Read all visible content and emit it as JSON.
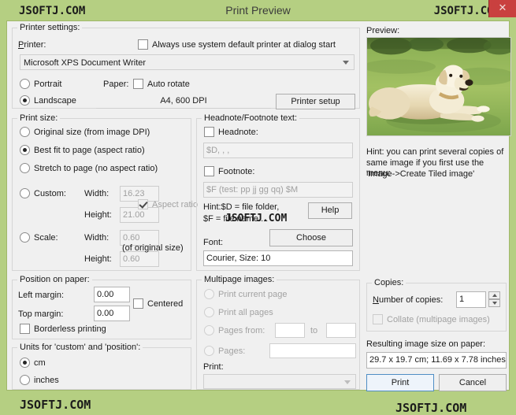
{
  "window": {
    "title": "Print Preview",
    "close_label": "✕",
    "watermark": "JSOFTJ.COM",
    "titlebar_color": "#b5cf82",
    "close_color": "#c9403f",
    "accent_color": "#4f8ec4"
  },
  "printer_settings": {
    "legend": "Printer settings:",
    "printer_label": "Printer:",
    "always_default_label": "Always use system default printer at dialog start",
    "always_default_checked": false,
    "printer_value": "Microsoft XPS Document Writer",
    "orientation": {
      "portrait_label": "Portrait",
      "landscape_label": "Landscape",
      "selected": "Landscape"
    },
    "paper_label": "Paper:",
    "auto_rotate_label": "Auto rotate",
    "auto_rotate_checked": false,
    "paper_value": "A4,      600 DPI",
    "printer_setup_label": "Printer setup"
  },
  "print_size": {
    "legend": "Print size:",
    "original_label": "Original size (from image DPI)",
    "best_fit_label": "Best fit to page (aspect ratio)",
    "stretch_label": "Stretch to page (no aspect ratio)",
    "custom_label": "Custom:",
    "scale_label": "Scale:",
    "selected": "best_fit",
    "width_label": "Width:",
    "height_label": "Height:",
    "custom_width": "16.23",
    "custom_height": "21.00",
    "aspect_ratio_label": "Aspect ratio",
    "aspect_ratio_checked": true,
    "scale_width": "0.60",
    "scale_height": "0.60",
    "of_original_label": "(of original size)"
  },
  "headnote": {
    "legend": "Headnote/Footnote text:",
    "headnote_label": "Headnote:",
    "headnote_checked": false,
    "headnote_value": "$D, , ,",
    "footnote_label": "Footnote:",
    "footnote_checked": false,
    "footnote_value": "$F (test: pp jj gg qq) $M",
    "hint_line1": "Hint:$D = file folder,",
    "hint_line2": "$F = file name ...",
    "help_label": "Help",
    "font_label": "Font:",
    "choose_label": "Choose",
    "font_value": "Courier, Size: 10"
  },
  "position": {
    "legend": "Position on paper:",
    "left_margin_label": "Left margin:",
    "left_margin_value": "0.00",
    "top_margin_label": "Top margin:",
    "top_margin_value": "0.00",
    "centered_label": "Centered",
    "centered_checked": false,
    "borderless_label": "Borderless printing",
    "borderless_checked": false
  },
  "units": {
    "legend": "Units for 'custom' and 'position':",
    "cm_label": "cm",
    "inches_label": "inches",
    "selected": "cm"
  },
  "multipage": {
    "legend": "Multipage images:",
    "print_current_label": "Print current page",
    "print_all_label": "Print all pages",
    "pages_from_label": "Pages from:",
    "pages_from_value": "",
    "to_label": "to",
    "pages_to_value": "",
    "pages_label": "Pages:",
    "pages_value": "",
    "print_label": "Print:",
    "print_value": "",
    "disabled": true
  },
  "preview": {
    "label": "Preview:",
    "image_alt": "yellow labrador retriever lying on green grass"
  },
  "hint": {
    "line1": "Hint: you can print several copies of",
    "line2": "same image if you first use the menu:",
    "line3": "'Image->Create Tiled image'"
  },
  "copies": {
    "legend": "Copies:",
    "number_label": "Number of copies:",
    "number_value": "1",
    "collate_label": "Collate (multipage images)",
    "collate_checked": false,
    "collate_disabled": true
  },
  "result": {
    "label": "Resulting image size on paper:",
    "value": "29.7 x 19.7 cm; 11.69 x 7.78 inches"
  },
  "actions": {
    "print_label": "Print",
    "cancel_label": "Cancel"
  }
}
